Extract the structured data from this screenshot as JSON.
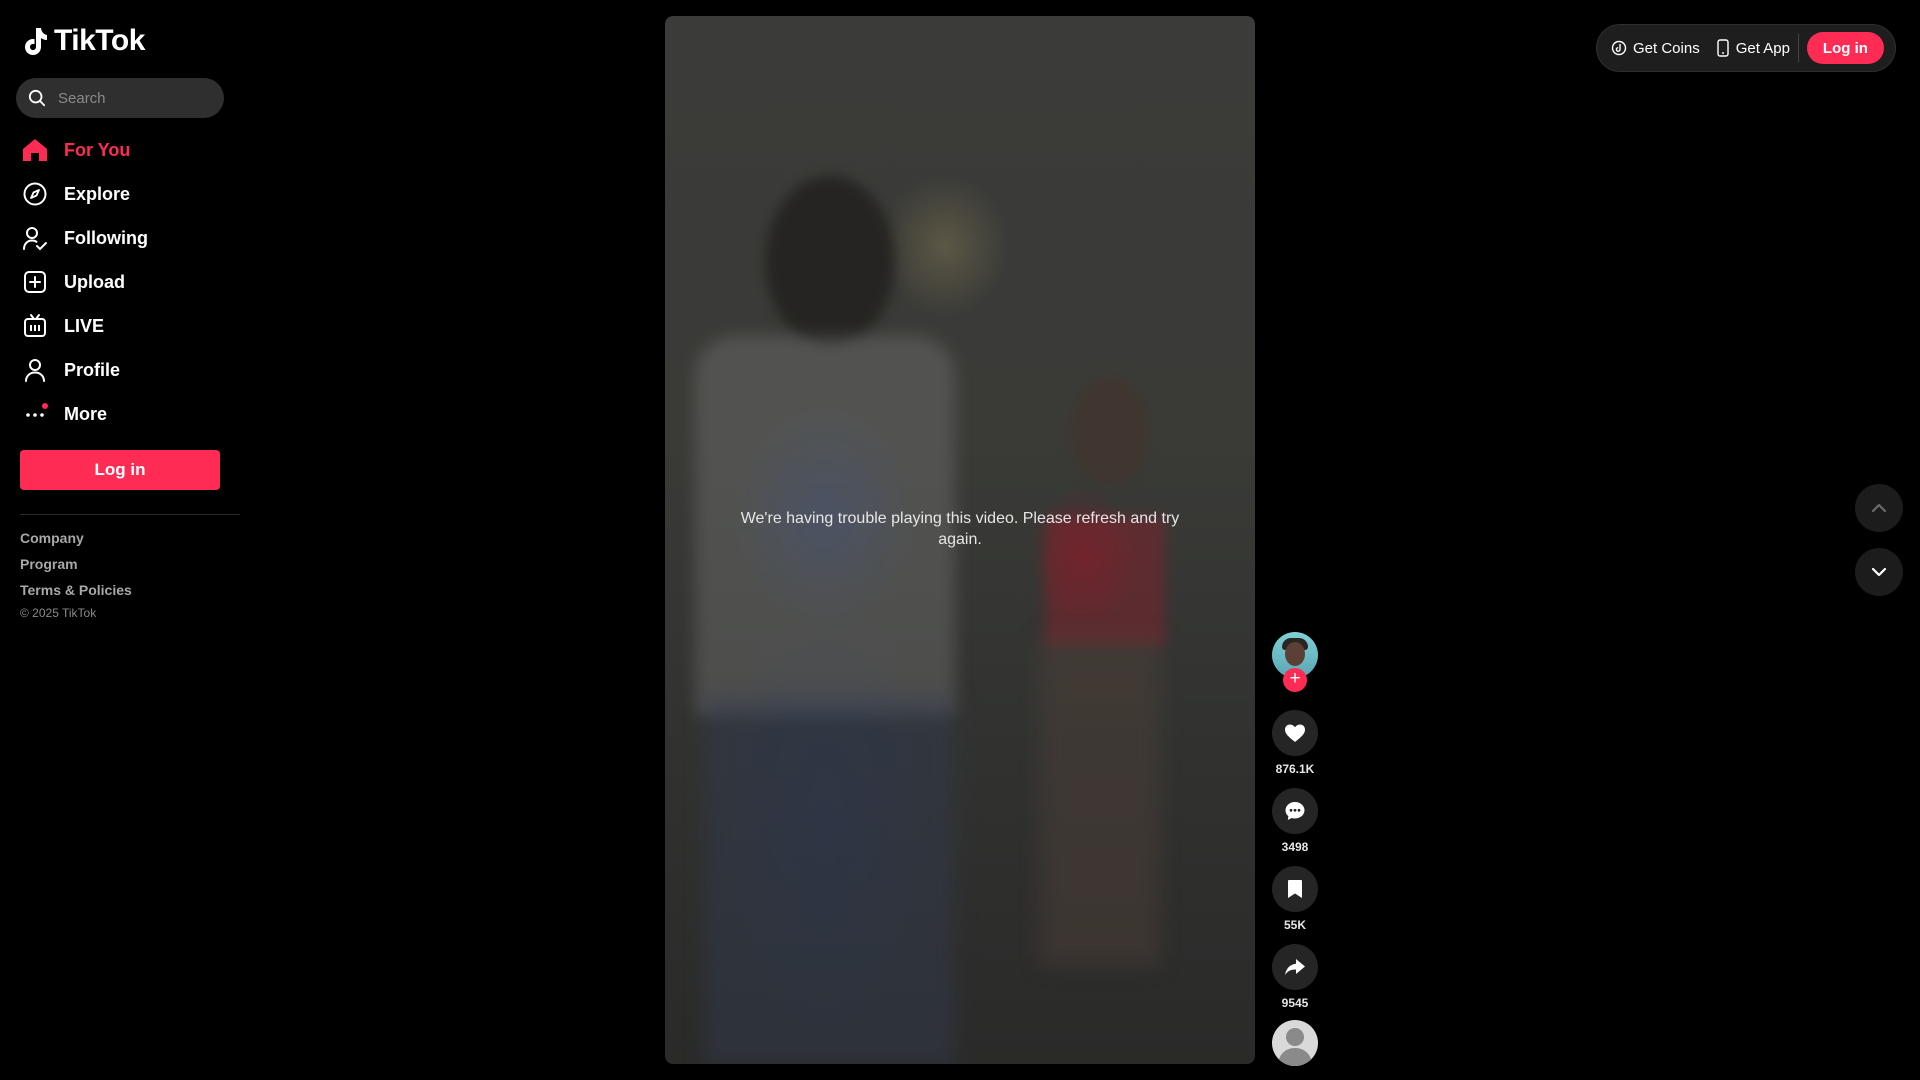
{
  "app": {
    "name": "TikTok"
  },
  "search": {
    "placeholder": "Search"
  },
  "nav": [
    {
      "label": "For You",
      "icon": "home-icon",
      "active": true
    },
    {
      "label": "Explore",
      "icon": "compass-icon"
    },
    {
      "label": "Following",
      "icon": "following-icon"
    },
    {
      "label": "Upload",
      "icon": "upload-icon"
    },
    {
      "label": "LIVE",
      "icon": "live-icon"
    },
    {
      "label": "Profile",
      "icon": "profile-icon"
    },
    {
      "label": "More",
      "icon": "more-icon"
    }
  ],
  "sidebar": {
    "login_label": "Log in"
  },
  "footer": {
    "links": [
      "Company",
      "Program",
      "Terms & Policies"
    ],
    "copyright": "© 2025 TikTok"
  },
  "video": {
    "error_message": "We're having trouble playing this video. Please refresh and try again."
  },
  "actions": {
    "likes": "876.1K",
    "comments": "3498",
    "saves": "55K",
    "shares": "9545"
  },
  "topbar": {
    "get_coins": "Get Coins",
    "get_app": "Get App",
    "login_label": "Log in"
  },
  "colors": {
    "accent": "#fe2c55",
    "background": "#000000",
    "panel": "#252525"
  }
}
